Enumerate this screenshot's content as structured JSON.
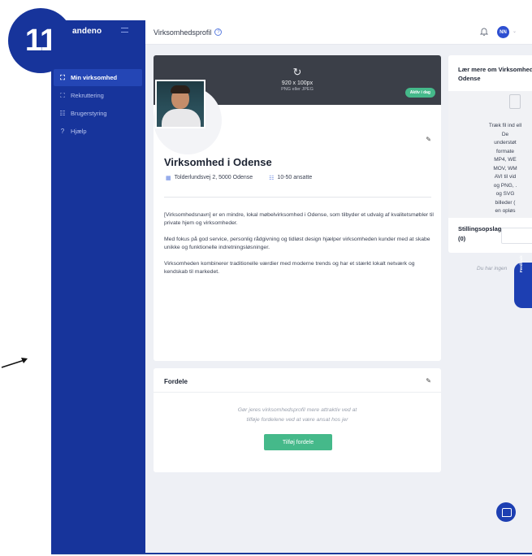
{
  "step_badge": "11",
  "sidebar": {
    "logo": "andeno",
    "items": [
      {
        "label": "Min virksomhed",
        "icon": "company-icon",
        "glyph": "⛶",
        "active": true
      },
      {
        "label": "Rekruttering",
        "icon": "recruitment-icon",
        "glyph": "⛶",
        "active": false
      },
      {
        "label": "Brugerstyring",
        "icon": "users-icon",
        "glyph": "☷",
        "active": false
      },
      {
        "label": "Hjælp",
        "icon": "help-icon",
        "glyph": "?",
        "active": false
      }
    ]
  },
  "topbar": {
    "title": "Virksomhedsprofil",
    "help_glyph": "?",
    "bell_glyph": "🔔",
    "avatar_initials": "NN",
    "chevron": "⌄"
  },
  "profile": {
    "cover_icon": "↻",
    "cover_size": "920 x 100px",
    "cover_format": "PNG eller JPEG",
    "badge": "Aktiv i dag",
    "edit_glyph": "✎",
    "company_name": "Virksomhed i Odense",
    "address_icon": "▦",
    "address": "Tolderlundsvej 2, 5000 Odense",
    "employees_icon": "☷",
    "employees": "10-50 ansatte",
    "paragraphs": [
      "[Virksomhedsnavn] er en mindre, lokal møbelvirksomhed i Odense, som tilbyder et udvalg af kvalitetsmøbler til private hjem og virksomheder.",
      "Med fokus på god service, personlig rådgivning og tidløst design hjælper virksomheden kunder med at skabe unikke og funktionelle indretningsløsninger.",
      "Virksomheden kombinerer traditionelle værdier med moderne trends og har et stærkt lokalt netværk og kendskab til markedet."
    ]
  },
  "benefits": {
    "title": "Fordele",
    "edit_glyph": "✎",
    "hint_line1": "Gør jeres virksomhedsprofil mere attraktiv ved at",
    "hint_line2": "tilføje fordelene ved at være ansat hos jer",
    "button": "Tilføj fordele"
  },
  "side_panel": {
    "learn_title": "Lær mere om Virksomhed i Odense",
    "upload_lines": [
      "Træk fil ind ell",
      "De",
      "understøt",
      "formate",
      "MP4, WE",
      "MOV, WM",
      "AVI til vid",
      "og PNG, .",
      "og SVG",
      "billeder (",
      "en opløs"
    ],
    "jobs_title_1": "Stillingsopslag",
    "jobs_title_2": "(0)",
    "no_jobs": "Du har ingen",
    "feedback": "Feedback"
  },
  "colors": {
    "brand_blue": "#17349b",
    "accent_green": "#45b98a"
  }
}
